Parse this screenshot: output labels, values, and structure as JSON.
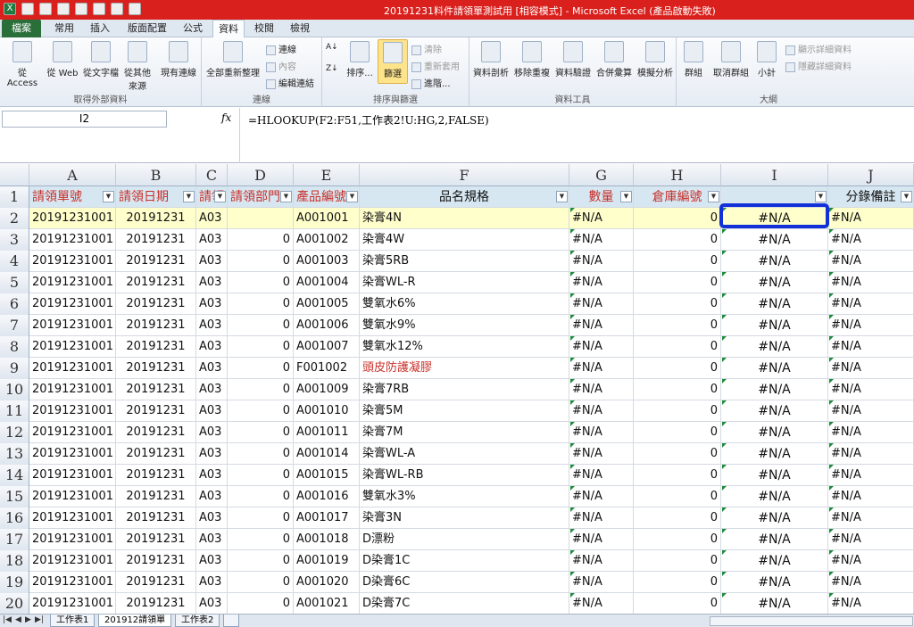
{
  "window": {
    "title": "20191231料件請領單測試用 [相容模式] - Microsoft Excel (產品啟動失敗)"
  },
  "tabs": [
    {
      "label": "檔案"
    },
    {
      "label": "常用"
    },
    {
      "label": "插入"
    },
    {
      "label": "版面配置"
    },
    {
      "label": "公式"
    },
    {
      "label": "資料"
    },
    {
      "label": "校閱"
    },
    {
      "label": "檢視"
    }
  ],
  "ribbon": {
    "g1": {
      "label": "取得外部資料",
      "b1": "從 Access",
      "b2": "從 Web",
      "b3": "從文字檔",
      "b4": "從其他\n來源",
      "b5": "現有連線"
    },
    "g2": {
      "label": "連線",
      "b1": "全部重新整理",
      "s1": "連線",
      "s2": "內容",
      "s3": "編輯連結"
    },
    "g3": {
      "label": "排序與篩選",
      "b1": "排序...",
      "b2": "篩選",
      "s1": "清除",
      "s2": "重新套用",
      "s3": "進階..."
    },
    "g4": {
      "label": "資料工具",
      "b1": "資料剖析",
      "b2": "移除重複",
      "b3": "資料驗證",
      "b4": "合併彙算",
      "b5": "模擬分析"
    },
    "g5": {
      "label": "大綱",
      "b1": "群組",
      "b2": "取消群組",
      "b3": "小計",
      "s1": "顯示詳細資料",
      "s2": "隱藏詳細資料"
    }
  },
  "formula_bar": {
    "name_box": "I2",
    "fx": "fx",
    "formula": "=HLOOKUP(F2:F51,工作表2!U:HG,2,FALSE)"
  },
  "columns": [
    "A",
    "B",
    "C",
    "D",
    "E",
    "F",
    "G",
    "H",
    "I",
    "J"
  ],
  "header_row": {
    "num": "1",
    "A": "請領單號",
    "B": "請領日期",
    "C": "請領",
    "D": "請領部門",
    "E": "產品編號",
    "F": "品名規格",
    "G": "數量",
    "H": "倉庫編號",
    "I": "",
    "J": "分錄備註"
  },
  "rows": [
    {
      "num": "2",
      "A": "20191231001",
      "B": "20191231",
      "C": "A03",
      "D": "",
      "E": "A001001",
      "F": "染膏4N",
      "G": "#N/A",
      "H": "0",
      "I": "#N/A",
      "J": "#N/A"
    },
    {
      "num": "3",
      "A": "20191231001",
      "B": "20191231",
      "C": "A03",
      "D": "0",
      "E": "A001002",
      "F": "染膏4W",
      "G": "#N/A",
      "H": "0",
      "I": "#N/A",
      "J": "#N/A"
    },
    {
      "num": "4",
      "A": "20191231001",
      "B": "20191231",
      "C": "A03",
      "D": "0",
      "E": "A001003",
      "F": "染膏5RB",
      "G": "#N/A",
      "H": "0",
      "I": "#N/A",
      "J": "#N/A"
    },
    {
      "num": "5",
      "A": "20191231001",
      "B": "20191231",
      "C": "A03",
      "D": "0",
      "E": "A001004",
      "F": "染膏WL-R",
      "G": "#N/A",
      "H": "0",
      "I": "#N/A",
      "J": "#N/A"
    },
    {
      "num": "6",
      "A": "20191231001",
      "B": "20191231",
      "C": "A03",
      "D": "0",
      "E": "A001005",
      "F": "雙氧水6%",
      "G": "#N/A",
      "H": "0",
      "I": "#N/A",
      "J": "#N/A"
    },
    {
      "num": "7",
      "A": "20191231001",
      "B": "20191231",
      "C": "A03",
      "D": "0",
      "E": "A001006",
      "F": "雙氧水9%",
      "G": "#N/A",
      "H": "0",
      "I": "#N/A",
      "J": "#N/A"
    },
    {
      "num": "8",
      "A": "20191231001",
      "B": "20191231",
      "C": "A03",
      "D": "0",
      "E": "A001007",
      "F": "雙氧水12%",
      "G": "#N/A",
      "H": "0",
      "I": "#N/A",
      "J": "#N/A"
    },
    {
      "num": "9",
      "A": "20191231001",
      "B": "20191231",
      "C": "A03",
      "D": "0",
      "E": "F001002",
      "F": "頭皮防護凝膠",
      "G": "#N/A",
      "H": "0",
      "I": "#N/A",
      "J": "#N/A"
    },
    {
      "num": "10",
      "A": "20191231001",
      "B": "20191231",
      "C": "A03",
      "D": "0",
      "E": "A001009",
      "F": "染膏7RB",
      "G": "#N/A",
      "H": "0",
      "I": "#N/A",
      "J": "#N/A"
    },
    {
      "num": "11",
      "A": "20191231001",
      "B": "20191231",
      "C": "A03",
      "D": "0",
      "E": "A001010",
      "F": "染膏5M",
      "G": "#N/A",
      "H": "0",
      "I": "#N/A",
      "J": "#N/A"
    },
    {
      "num": "12",
      "A": "20191231001",
      "B": "20191231",
      "C": "A03",
      "D": "0",
      "E": "A001011",
      "F": "染膏7M",
      "G": "#N/A",
      "H": "0",
      "I": "#N/A",
      "J": "#N/A"
    },
    {
      "num": "13",
      "A": "20191231001",
      "B": "20191231",
      "C": "A03",
      "D": "0",
      "E": "A001014",
      "F": "染膏WL-A",
      "G": "#N/A",
      "H": "0",
      "I": "#N/A",
      "J": "#N/A"
    },
    {
      "num": "14",
      "A": "20191231001",
      "B": "20191231",
      "C": "A03",
      "D": "0",
      "E": "A001015",
      "F": "染膏WL-RB",
      "G": "#N/A",
      "H": "0",
      "I": "#N/A",
      "J": "#N/A"
    },
    {
      "num": "15",
      "A": "20191231001",
      "B": "20191231",
      "C": "A03",
      "D": "0",
      "E": "A001016",
      "F": "雙氧水3%",
      "G": "#N/A",
      "H": "0",
      "I": "#N/A",
      "J": "#N/A"
    },
    {
      "num": "16",
      "A": "20191231001",
      "B": "20191231",
      "C": "A03",
      "D": "0",
      "E": "A001017",
      "F": "染膏3N",
      "G": "#N/A",
      "H": "0",
      "I": "#N/A",
      "J": "#N/A"
    },
    {
      "num": "17",
      "A": "20191231001",
      "B": "20191231",
      "C": "A03",
      "D": "0",
      "E": "A001018",
      "F": "D漂粉",
      "G": "#N/A",
      "H": "0",
      "I": "#N/A",
      "J": "#N/A"
    },
    {
      "num": "18",
      "A": "20191231001",
      "B": "20191231",
      "C": "A03",
      "D": "0",
      "E": "A001019",
      "F": "D染膏1C",
      "G": "#N/A",
      "H": "0",
      "I": "#N/A",
      "J": "#N/A"
    },
    {
      "num": "19",
      "A": "20191231001",
      "B": "20191231",
      "C": "A03",
      "D": "0",
      "E": "A001020",
      "F": "D染膏6C",
      "G": "#N/A",
      "H": "0",
      "I": "#N/A",
      "J": "#N/A"
    },
    {
      "num": "20",
      "A": "20191231001",
      "B": "20191231",
      "C": "A03",
      "D": "0",
      "E": "A001021",
      "F": "D染膏7C",
      "G": "#N/A",
      "H": "0",
      "I": "#N/A",
      "J": "#N/A"
    }
  ],
  "sheets": [
    {
      "label": "工作表1"
    },
    {
      "label": "201912請領單"
    },
    {
      "label": "工作表2"
    }
  ],
  "colors": {
    "title_bar": "#d9201c",
    "highlight": "#1230d8",
    "red_text": "#c8302a"
  }
}
